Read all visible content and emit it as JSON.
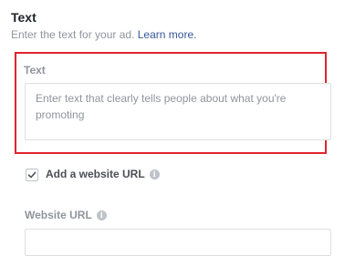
{
  "section": {
    "title": "Text",
    "subtitle": "Enter the text for your ad.",
    "learn_more": "Learn more."
  },
  "text_field": {
    "label": "Text",
    "placeholder": "Enter text that clearly tells people about what you're promoting"
  },
  "website_checkbox": {
    "label": "Add a website URL",
    "checked": true,
    "info_icon": "info-icon"
  },
  "website_url": {
    "label": "Website URL",
    "info_icon": "info-icon",
    "value": ""
  },
  "colors": {
    "highlight": "#e0242b",
    "link": "#365899",
    "muted": "#90949c"
  }
}
